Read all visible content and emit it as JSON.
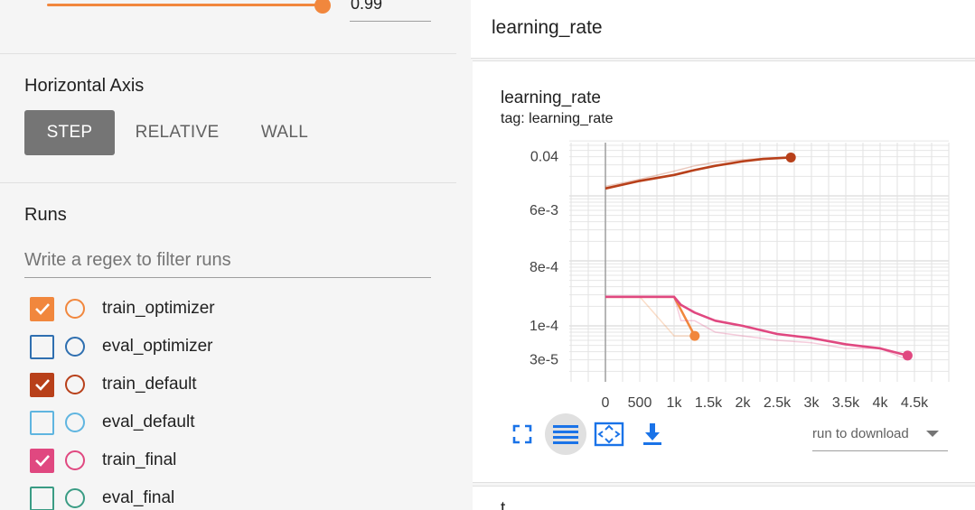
{
  "smoothing": {
    "value": "0.99",
    "fill_fraction": 0.99
  },
  "horizontal_axis": {
    "title": "Horizontal Axis",
    "options": [
      {
        "label": "STEP",
        "active": true
      },
      {
        "label": "RELATIVE",
        "active": false
      },
      {
        "label": "WALL",
        "active": false
      }
    ]
  },
  "runs": {
    "title": "Runs",
    "filter_placeholder": "Write a regex to filter runs",
    "items": [
      {
        "label": "train_optimizer",
        "checked": true,
        "color": "#f1873d"
      },
      {
        "label": "eval_optimizer",
        "checked": false,
        "color": "#2f6fb0"
      },
      {
        "label": "train_default",
        "checked": true,
        "color": "#b8401a"
      },
      {
        "label": "eval_default",
        "checked": false,
        "color": "#5fb5e0"
      },
      {
        "label": "train_final",
        "checked": true,
        "color": "#e04880"
      },
      {
        "label": "eval_final",
        "checked": false,
        "color": "#3a9c84"
      }
    ]
  },
  "main": {
    "group_title": "learning_rate",
    "card": {
      "title": "learning_rate",
      "tag": "tag: learning_rate",
      "download_label": "run to download",
      "next_card_title": "t"
    }
  },
  "chart_data": {
    "type": "line",
    "title": "learning_rate",
    "xlabel": "",
    "ylabel": "",
    "y_scale": "log",
    "xlim": [
      -1000,
      5000
    ],
    "ylim": [
      1e-05,
      0.1
    ],
    "x_ticks": [
      0,
      500,
      1000,
      1500,
      2000,
      2500,
      3000,
      3500,
      4000,
      4500
    ],
    "x_tick_labels": [
      "0",
      "500",
      "1k",
      "1.5k",
      "2k",
      "2.5k",
      "3k",
      "3.5k",
      "4k",
      "4.5k"
    ],
    "y_ticks": [
      0.04,
      0.006,
      0.0008,
      0.0001,
      3e-05
    ],
    "y_tick_labels": [
      "0.04",
      "6e-3",
      "8e-4",
      "1e-4",
      "3e-5"
    ],
    "grid": true,
    "series": [
      {
        "run": "train_default",
        "color": "#b8401a",
        "x": [
          0,
          500,
          1000,
          1300,
          1600,
          2000,
          2300,
          2700
        ],
        "raw": [
          0.014,
          0.018,
          0.024,
          0.029,
          0.033,
          0.036,
          0.038,
          0.039
        ],
        "smoothed": [
          0.013,
          0.017,
          0.021,
          0.025,
          0.029,
          0.034,
          0.037,
          0.039
        ]
      },
      {
        "run": "train_optimizer",
        "color": "#f1873d",
        "x": [
          0,
          500,
          1000,
          1300
        ],
        "raw": [
          0.00028,
          0.00028,
          7e-05,
          7e-05
        ],
        "smoothed": [
          0.00028,
          0.00028,
          0.00028,
          7e-05
        ]
      },
      {
        "run": "train_final",
        "color": "#e04880",
        "x": [
          0,
          500,
          1000,
          1100,
          1300,
          1600,
          2000,
          2500,
          3000,
          3500,
          4000,
          4400
        ],
        "raw": [
          0.00028,
          0.00028,
          0.00028,
          0.00012,
          0.00012,
          8e-05,
          7e-05,
          6e-05,
          5.5e-05,
          4.5e-05,
          4.5e-05,
          3e-05
        ],
        "smoothed": [
          0.00028,
          0.00028,
          0.00028,
          0.00021,
          0.00016,
          0.00012,
          0.0001,
          7.5e-05,
          6.5e-05,
          5.2e-05,
          4.5e-05,
          3.5e-05
        ]
      }
    ]
  }
}
